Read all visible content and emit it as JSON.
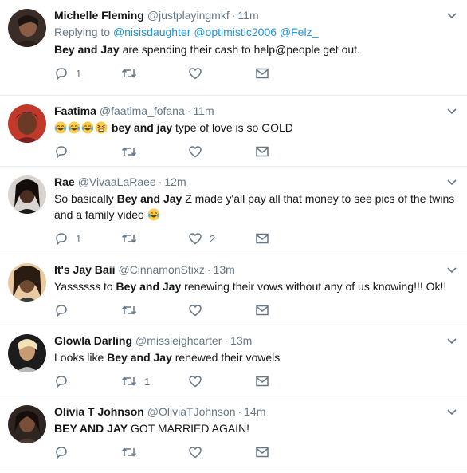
{
  "tweets": [
    {
      "name": "Michelle Fleming",
      "handle": "@justplayingmkf",
      "time": "11m",
      "reply_prefix": "Replying to",
      "reply_to": [
        "@nisisdaughter",
        "@optimistic2006",
        "@Felz_"
      ],
      "text_bold": "Bey and Jay",
      "text_rest": " are spending their cash to help@people get out.",
      "replies": "1",
      "retweets": "",
      "likes": ""
    },
    {
      "name": "Faatima",
      "handle": "@faatima_fofana",
      "time": "11m",
      "emojis": [
        "joy",
        "joy",
        "joy",
        "tired"
      ],
      "text_bold": "bey and jay",
      "text_rest": " type of love is so GOLD",
      "replies": "",
      "retweets": "",
      "likes": ""
    },
    {
      "name": "Rae",
      "handle": "@VivaaLaRaee",
      "time": "12m",
      "text_pre": "So basically ",
      "text_bold": "Bey and Jay",
      "text_rest": " Z made y'all pay all that money to see pics of the twins and a family video",
      "trailing_emoji": "joy",
      "replies": "1",
      "retweets": "",
      "likes": "2"
    },
    {
      "name": "It's Jay Baii",
      "handle": "@CinnamonStixz",
      "time": "13m",
      "text_pre": "Yassssss to ",
      "text_bold": "Bey and Jay",
      "text_rest": " renewing their vows without any of us knowing!!! Ok!!",
      "replies": "",
      "retweets": "",
      "likes": ""
    },
    {
      "name": "Glowla Darling",
      "handle": "@missleighcarter",
      "time": "13m",
      "text_pre": "Looks like ",
      "text_bold": "Bey and Jay",
      "text_rest": " renewed their vowels",
      "replies": "",
      "retweets": "1",
      "likes": ""
    },
    {
      "name": "Olivia T Johnson",
      "handle": "@OliviaTJohnson",
      "time": "14m",
      "text_pre": "BEY AND JAY GOT MARRIED AGAIN!",
      "replies": "",
      "retweets": "",
      "likes": ""
    }
  ],
  "icons": {
    "reply": "reply-icon",
    "retweet": "retweet-icon",
    "like": "heart-icon",
    "dm": "envelope-icon",
    "caret": "chevron-down-icon"
  },
  "colors": {
    "link": "#1b95e0",
    "secondary": "#657786",
    "text": "#14171a",
    "divider": "#e6ecf0"
  }
}
